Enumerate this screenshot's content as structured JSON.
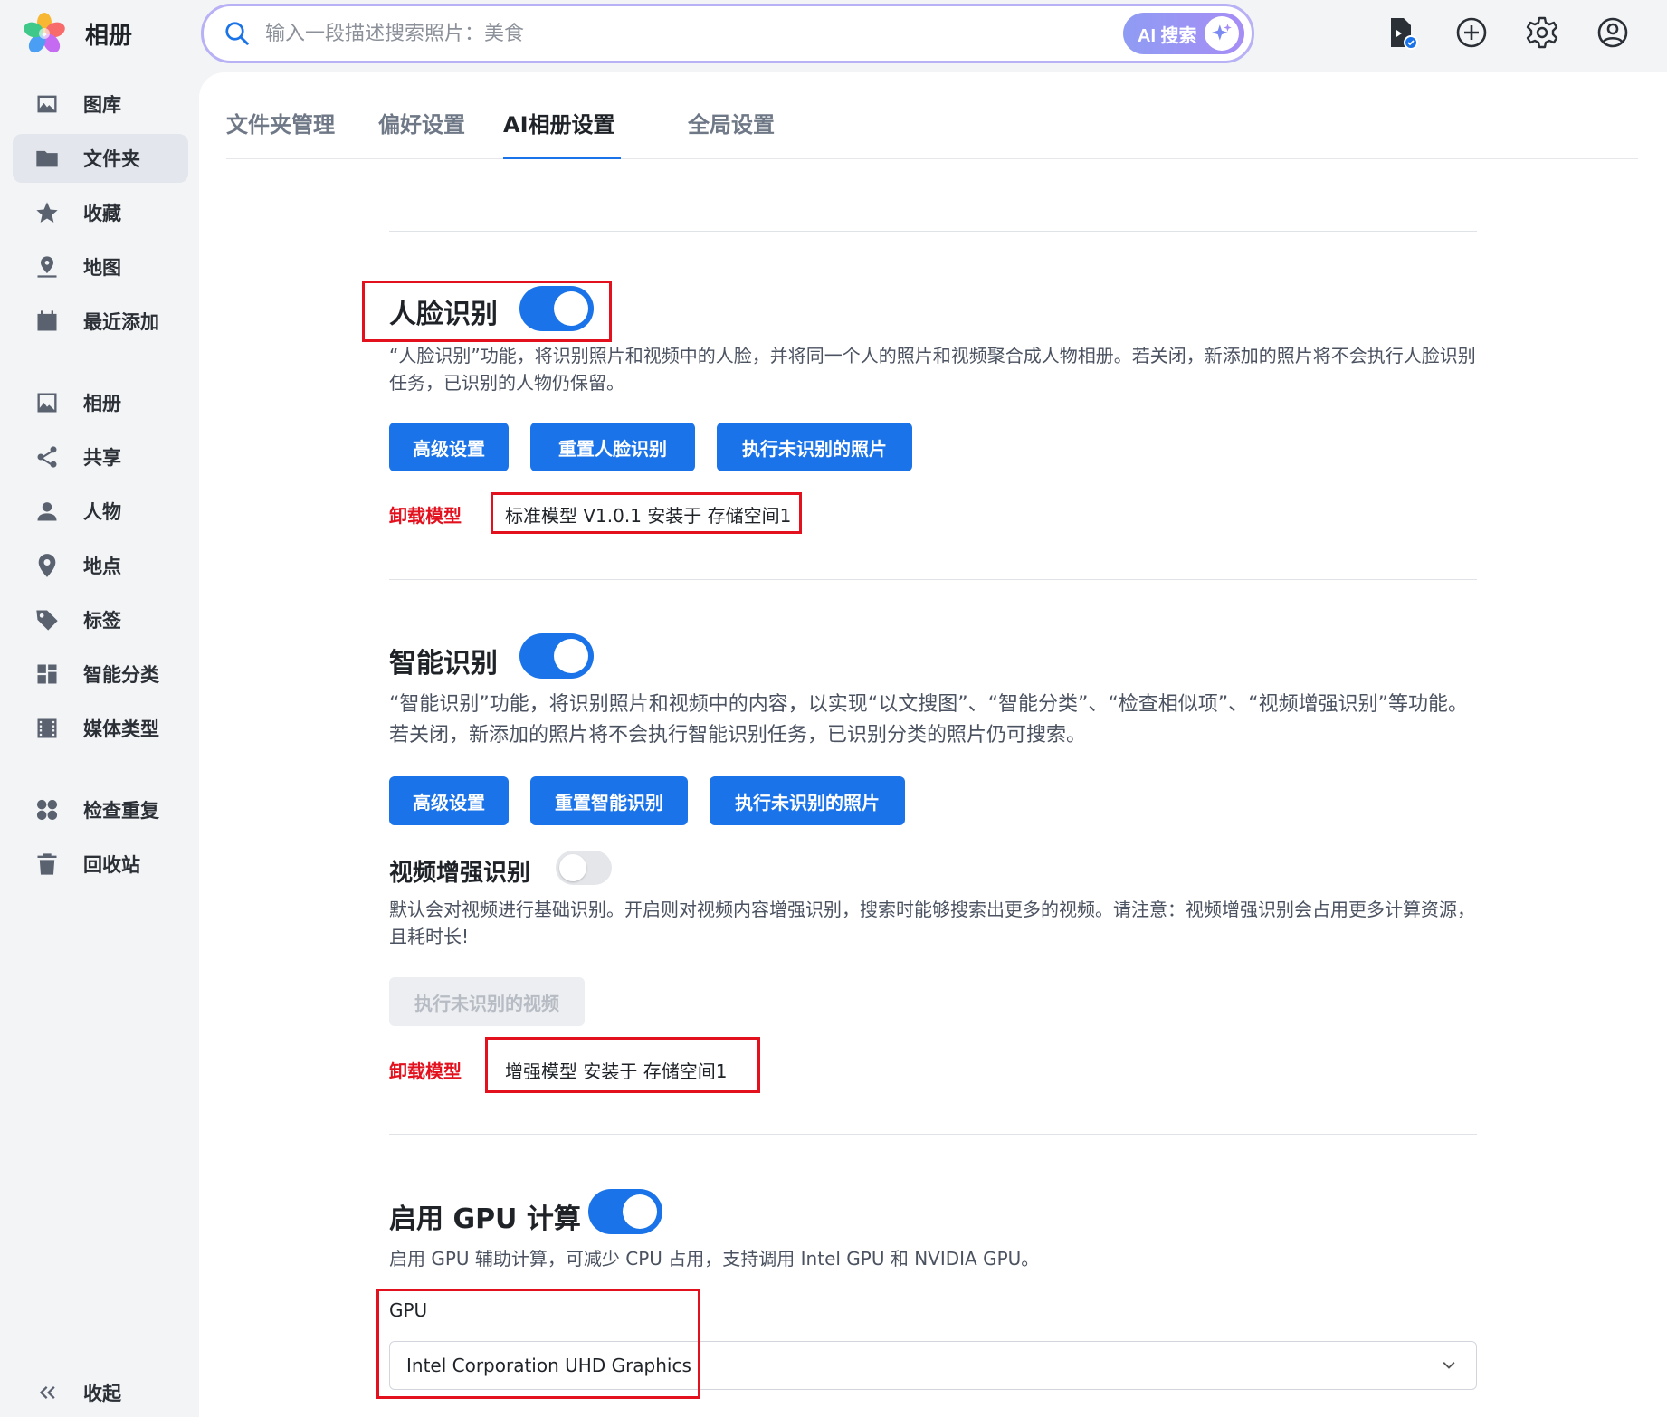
{
  "app": {
    "title": "相册"
  },
  "search": {
    "placeholder": "输入一段描述搜索照片：美食",
    "ai_button": "AI 搜索"
  },
  "sidebar": {
    "items": [
      {
        "label": "图库",
        "icon": "image-icon"
      },
      {
        "label": "文件夹",
        "icon": "folder-icon",
        "active": true
      },
      {
        "label": "收藏",
        "icon": "star-icon"
      },
      {
        "label": "地图",
        "icon": "map-pin-icon"
      },
      {
        "label": "最近添加",
        "icon": "calendar-icon"
      },
      {
        "label": "相册",
        "icon": "album-icon"
      },
      {
        "label": "共享",
        "icon": "share-icon"
      },
      {
        "label": "人物",
        "icon": "person-icon"
      },
      {
        "label": "地点",
        "icon": "location-icon"
      },
      {
        "label": "标签",
        "icon": "tag-icon"
      },
      {
        "label": "智能分类",
        "icon": "grid-icon"
      },
      {
        "label": "媒体类型",
        "icon": "film-icon"
      },
      {
        "label": "检查重复",
        "icon": "duplicate-icon"
      },
      {
        "label": "回收站",
        "icon": "trash-icon"
      }
    ],
    "collapse_label": "收起"
  },
  "tabs": [
    {
      "label": "文件夹管理"
    },
    {
      "label": "偏好设置"
    },
    {
      "label": "AI相册设置",
      "active": true
    },
    {
      "label": "全局设置"
    }
  ],
  "face": {
    "title": "人脸识别",
    "enabled": true,
    "desc": "“人脸识别”功能，将识别照片和视频中的人脸，并将同一个人的照片和视频聚合成人物相册。若关闭，新添加的照片将不会执行人脸识别任务，已识别的人物仍保留。",
    "buttons": [
      "高级设置",
      "重置人脸识别",
      "执行未识别的照片"
    ],
    "uninstall": "卸载模型",
    "model": "标准模型 V1.0.1 安装于 存储空间1"
  },
  "smart": {
    "title": "智能识别",
    "enabled": true,
    "desc": "“智能识别”功能，将识别照片和视频中的内容，以实现“以文搜图”、“智能分类”、“检查相似项”、“视频增强识别”等功能。若关闭，新添加的照片将不会执行智能识别任务，已识别分类的照片仍可搜索。",
    "buttons": [
      "高级设置",
      "重置智能识别",
      "执行未识别的照片"
    ]
  },
  "video": {
    "title": "视频增强识别",
    "enabled": false,
    "desc": "默认会对视频进行基础识别。开启则对视频内容增强识别，搜索时能够搜索出更多的视频。请注意：视频增强识别会占用更多计算资源，且耗时长!",
    "button": "执行未识别的视频",
    "uninstall": "卸载模型",
    "model": "增强模型 安装于 存储空间1"
  },
  "gpu": {
    "title": "启用 GPU 计算",
    "enabled": true,
    "desc": "启用 GPU 辅助计算，可减少 CPU 占用，支持调用 Intel GPU 和 NVIDIA GPU。",
    "label": "GPU",
    "selected": "Intel Corporation UHD Graphics"
  },
  "colors": {
    "accent": "#1a73e8",
    "danger": "#e3101e",
    "search_border": "#b8b1f5"
  }
}
